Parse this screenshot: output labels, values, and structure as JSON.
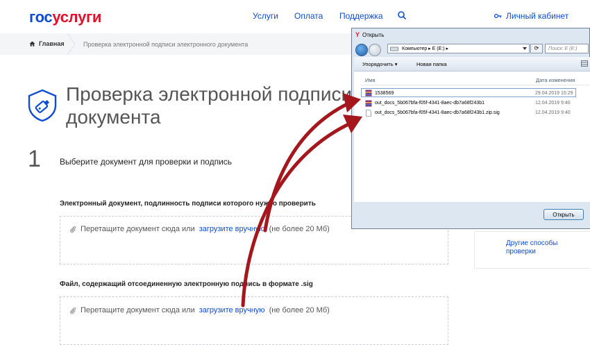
{
  "header": {
    "logo_part1": "гос",
    "logo_part2": "услуги",
    "nav": [
      "Услуги",
      "Оплата",
      "Поддержка"
    ],
    "cabinet": "Личный кабинет"
  },
  "breadcrumb": {
    "home": "Главная",
    "current": "Проверка электронной подписи электронного документа"
  },
  "page": {
    "title": "Проверка электронной подписи документа",
    "step_number": "1",
    "step_text": "Выберите документ для проверки и подпись",
    "field1_label": "Электронный документ, подлинность подписи которого нужно проверить",
    "field2_label": "Файл, содержащий отсоединенную электронную подпись в формате .sig",
    "drop_prefix": "Перетащите документ сюда или",
    "drop_link": "загрузите вручную",
    "drop_suffix": "(не более 20 Мб)",
    "side_link": "Другие способы проверки"
  },
  "dialog": {
    "title_icon": "Y",
    "title": "Открыть",
    "address": "Компьютер ▸ E (E:) ▸",
    "search_placeholder": "Поиск: E (E:)",
    "toolbar_organize": "Упорядочить ▾",
    "toolbar_new_folder": "Новая папка",
    "col_name": "Имя",
    "col_date": "Дата изменения",
    "files": [
      {
        "name": "1538569",
        "date": "29.04.2019 15:29",
        "icon": "archive-icon"
      },
      {
        "name": "out_docs_5b067bfa-f05f-4341-8aec-db7a68f243b1",
        "date": "12.04.2019 9:40",
        "icon": "archive-icon"
      },
      {
        "name": "out_docs_5b067bfa-f05f-4341-8aec-db7a68f243b1.zip.sig",
        "date": "12.04.2019 9:40",
        "icon": "file-icon"
      }
    ],
    "open_button": "Открыть"
  },
  "colors": {
    "brand_blue": "#0d4cd3",
    "brand_red": "#e2102a",
    "arrow": "#a3171d"
  }
}
